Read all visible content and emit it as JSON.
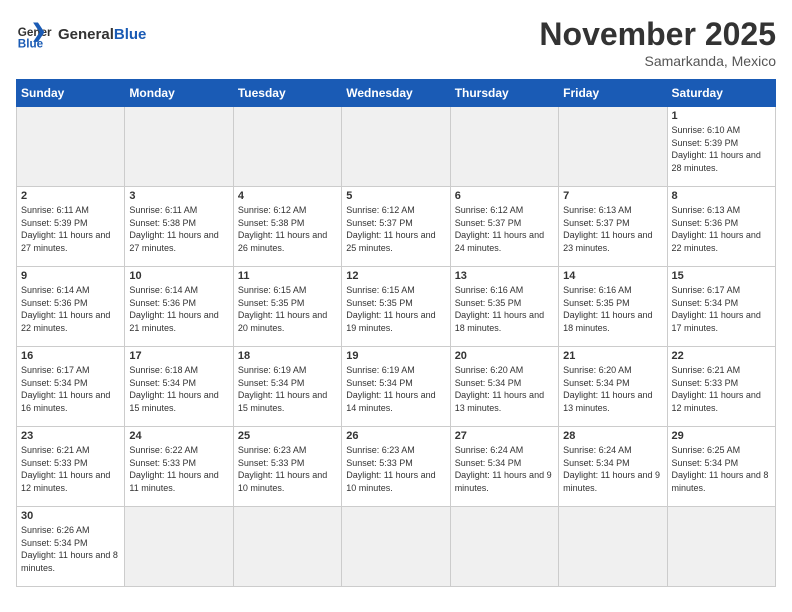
{
  "header": {
    "logo_general": "General",
    "logo_blue": "Blue",
    "month_title": "November 2025",
    "location": "Samarkanda, Mexico"
  },
  "weekdays": [
    "Sunday",
    "Monday",
    "Tuesday",
    "Wednesday",
    "Thursday",
    "Friday",
    "Saturday"
  ],
  "days": [
    {
      "num": "",
      "empty": true
    },
    {
      "num": "",
      "empty": true
    },
    {
      "num": "",
      "empty": true
    },
    {
      "num": "",
      "empty": true
    },
    {
      "num": "",
      "empty": true
    },
    {
      "num": "",
      "empty": true
    },
    {
      "num": "1",
      "sunrise": "6:10 AM",
      "sunset": "5:39 PM",
      "daylight": "11 hours and 28 minutes."
    },
    {
      "num": "2",
      "sunrise": "6:11 AM",
      "sunset": "5:39 PM",
      "daylight": "11 hours and 27 minutes."
    },
    {
      "num": "3",
      "sunrise": "6:11 AM",
      "sunset": "5:38 PM",
      "daylight": "11 hours and 27 minutes."
    },
    {
      "num": "4",
      "sunrise": "6:12 AM",
      "sunset": "5:38 PM",
      "daylight": "11 hours and 26 minutes."
    },
    {
      "num": "5",
      "sunrise": "6:12 AM",
      "sunset": "5:37 PM",
      "daylight": "11 hours and 25 minutes."
    },
    {
      "num": "6",
      "sunrise": "6:12 AM",
      "sunset": "5:37 PM",
      "daylight": "11 hours and 24 minutes."
    },
    {
      "num": "7",
      "sunrise": "6:13 AM",
      "sunset": "5:37 PM",
      "daylight": "11 hours and 23 minutes."
    },
    {
      "num": "8",
      "sunrise": "6:13 AM",
      "sunset": "5:36 PM",
      "daylight": "11 hours and 22 minutes."
    },
    {
      "num": "9",
      "sunrise": "6:14 AM",
      "sunset": "5:36 PM",
      "daylight": "11 hours and 22 minutes."
    },
    {
      "num": "10",
      "sunrise": "6:14 AM",
      "sunset": "5:36 PM",
      "daylight": "11 hours and 21 minutes."
    },
    {
      "num": "11",
      "sunrise": "6:15 AM",
      "sunset": "5:35 PM",
      "daylight": "11 hours and 20 minutes."
    },
    {
      "num": "12",
      "sunrise": "6:15 AM",
      "sunset": "5:35 PM",
      "daylight": "11 hours and 19 minutes."
    },
    {
      "num": "13",
      "sunrise": "6:16 AM",
      "sunset": "5:35 PM",
      "daylight": "11 hours and 18 minutes."
    },
    {
      "num": "14",
      "sunrise": "6:16 AM",
      "sunset": "5:35 PM",
      "daylight": "11 hours and 18 minutes."
    },
    {
      "num": "15",
      "sunrise": "6:17 AM",
      "sunset": "5:34 PM",
      "daylight": "11 hours and 17 minutes."
    },
    {
      "num": "16",
      "sunrise": "6:17 AM",
      "sunset": "5:34 PM",
      "daylight": "11 hours and 16 minutes."
    },
    {
      "num": "17",
      "sunrise": "6:18 AM",
      "sunset": "5:34 PM",
      "daylight": "11 hours and 15 minutes."
    },
    {
      "num": "18",
      "sunrise": "6:19 AM",
      "sunset": "5:34 PM",
      "daylight": "11 hours and 15 minutes."
    },
    {
      "num": "19",
      "sunrise": "6:19 AM",
      "sunset": "5:34 PM",
      "daylight": "11 hours and 14 minutes."
    },
    {
      "num": "20",
      "sunrise": "6:20 AM",
      "sunset": "5:34 PM",
      "daylight": "11 hours and 13 minutes."
    },
    {
      "num": "21",
      "sunrise": "6:20 AM",
      "sunset": "5:34 PM",
      "daylight": "11 hours and 13 minutes."
    },
    {
      "num": "22",
      "sunrise": "6:21 AM",
      "sunset": "5:33 PM",
      "daylight": "11 hours and 12 minutes."
    },
    {
      "num": "23",
      "sunrise": "6:21 AM",
      "sunset": "5:33 PM",
      "daylight": "11 hours and 12 minutes."
    },
    {
      "num": "24",
      "sunrise": "6:22 AM",
      "sunset": "5:33 PM",
      "daylight": "11 hours and 11 minutes."
    },
    {
      "num": "25",
      "sunrise": "6:23 AM",
      "sunset": "5:33 PM",
      "daylight": "11 hours and 10 minutes."
    },
    {
      "num": "26",
      "sunrise": "6:23 AM",
      "sunset": "5:33 PM",
      "daylight": "11 hours and 10 minutes."
    },
    {
      "num": "27",
      "sunrise": "6:24 AM",
      "sunset": "5:34 PM",
      "daylight": "11 hours and 9 minutes."
    },
    {
      "num": "28",
      "sunrise": "6:24 AM",
      "sunset": "5:34 PM",
      "daylight": "11 hours and 9 minutes."
    },
    {
      "num": "29",
      "sunrise": "6:25 AM",
      "sunset": "5:34 PM",
      "daylight": "11 hours and 8 minutes."
    },
    {
      "num": "30",
      "sunrise": "6:26 AM",
      "sunset": "5:34 PM",
      "daylight": "11 hours and 8 minutes."
    }
  ]
}
